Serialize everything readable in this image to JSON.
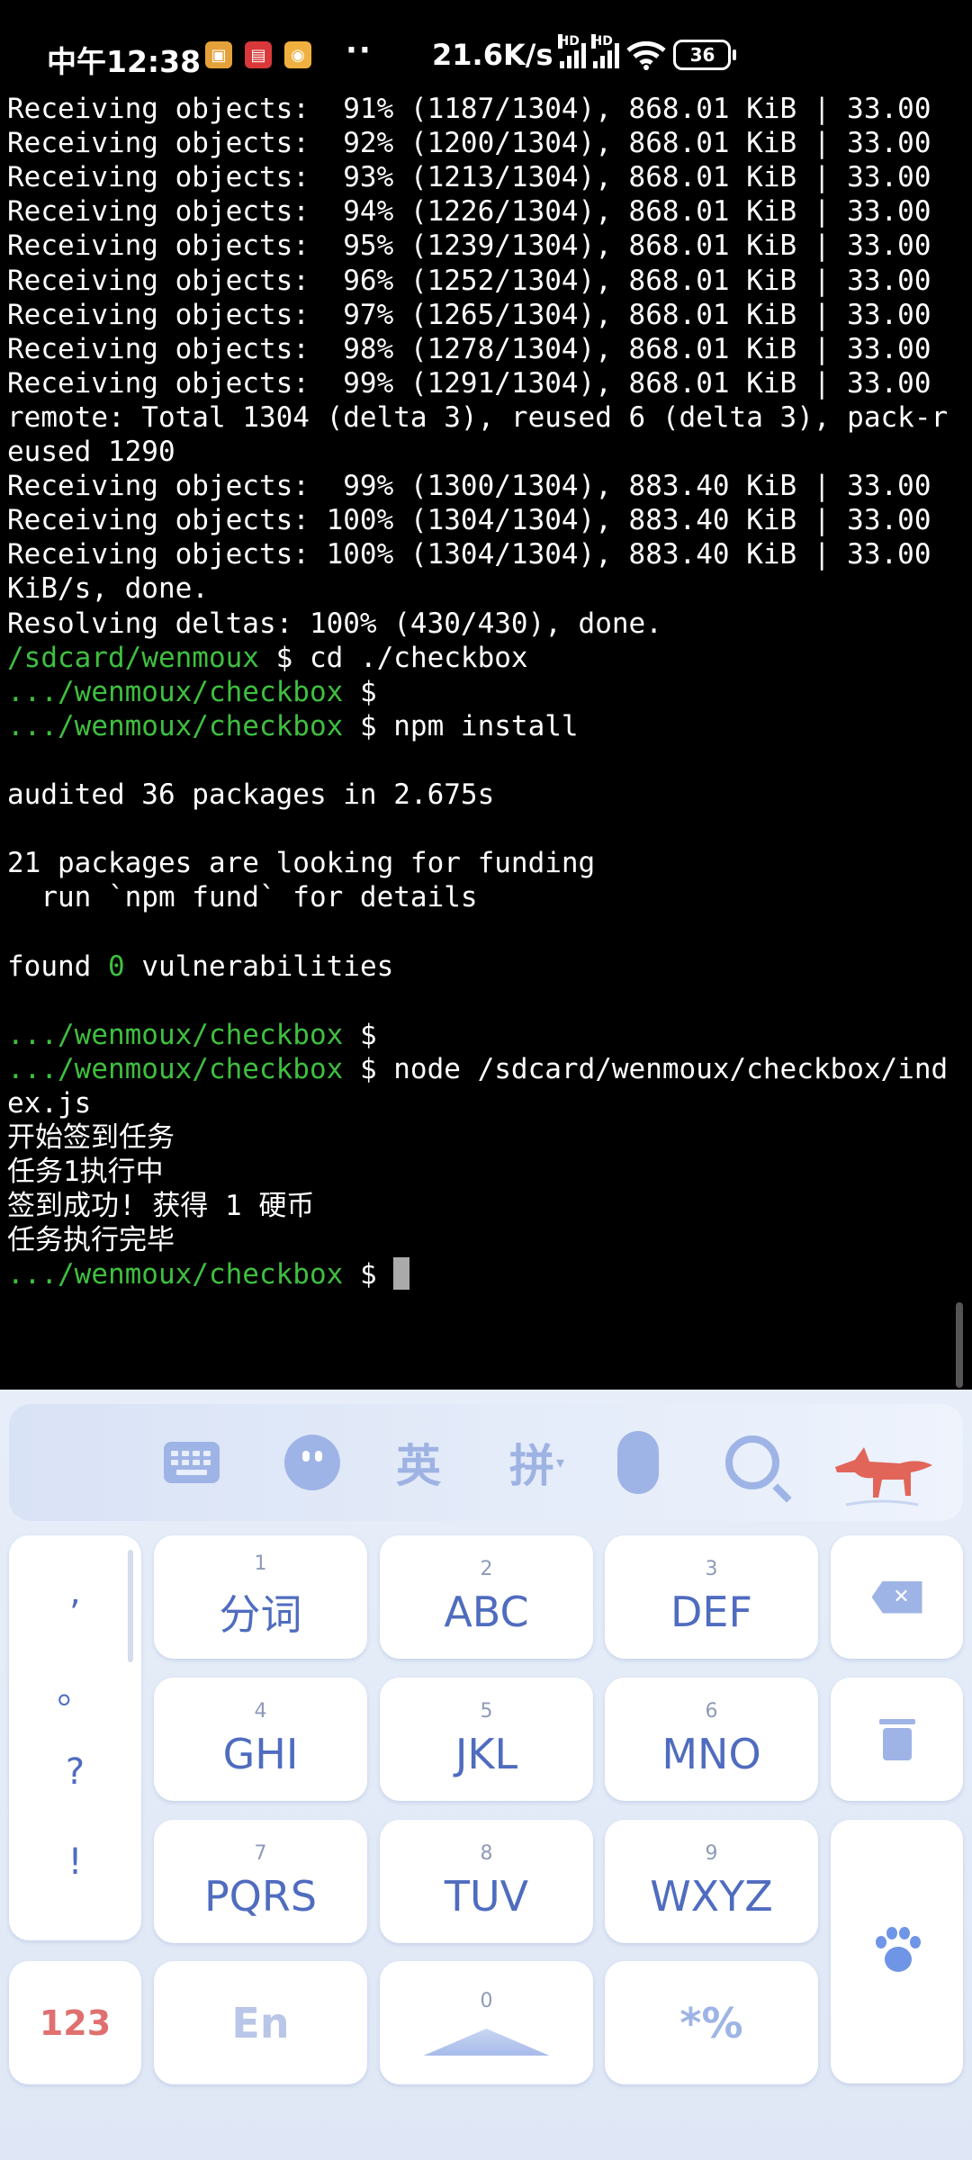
{
  "status_bar": {
    "time": "中午12:38",
    "dots": "··",
    "network_speed": "21.6K/s",
    "hd1": "HD",
    "hd2": "HD",
    "battery": "36"
  },
  "terminal": {
    "lines": [
      [
        {
          "t": "Receiving objects:  91% (1187/1304), 868.01 KiB | 33.00"
        }
      ],
      [
        {
          "t": "Receiving objects:  92% (1200/1304), 868.01 KiB | 33.00"
        }
      ],
      [
        {
          "t": "Receiving objects:  93% (1213/1304), 868.01 KiB | 33.00"
        }
      ],
      [
        {
          "t": "Receiving objects:  94% (1226/1304), 868.01 KiB | 33.00"
        }
      ],
      [
        {
          "t": "Receiving objects:  95% (1239/1304), 868.01 KiB | 33.00"
        }
      ],
      [
        {
          "t": "Receiving objects:  96% (1252/1304), 868.01 KiB | 33.00"
        }
      ],
      [
        {
          "t": "Receiving objects:  97% (1265/1304), 868.01 KiB | 33.00"
        }
      ],
      [
        {
          "t": "Receiving objects:  98% (1278/1304), 868.01 KiB | 33.00"
        }
      ],
      [
        {
          "t": "Receiving objects:  99% (1291/1304), 868.01 KiB | 33.00"
        }
      ],
      [
        {
          "t": "remote: Total 1304 (delta 3), reused 6 (delta 3), pack-r"
        }
      ],
      [
        {
          "t": "eused 1290"
        }
      ],
      [
        {
          "t": "Receiving objects:  99% (1300/1304), 883.40 KiB | 33.00"
        }
      ],
      [
        {
          "t": "Receiving objects: 100% (1304/1304), 883.40 KiB | 33.00"
        }
      ],
      [
        {
          "t": "Receiving objects: 100% (1304/1304), 883.40 KiB | 33.00"
        }
      ],
      [
        {
          "t": "KiB/s, done."
        }
      ],
      [
        {
          "t": "Resolving deltas: 100% (430/430), done."
        }
      ],
      [
        {
          "t": "/sdcard/wenmoux",
          "c": "green"
        },
        {
          "t": " $ cd ./checkbox"
        }
      ],
      [
        {
          "t": ".../wenmoux/checkbox",
          "c": "green"
        },
        {
          "t": " $"
        }
      ],
      [
        {
          "t": ".../wenmoux/checkbox",
          "c": "green"
        },
        {
          "t": " $ npm install"
        }
      ],
      [
        {
          "t": ""
        }
      ],
      [
        {
          "t": "audited 36 packages in 2.675s"
        }
      ],
      [
        {
          "t": ""
        }
      ],
      [
        {
          "t": "21 packages are looking for funding"
        }
      ],
      [
        {
          "t": "  run `npm fund` for details"
        }
      ],
      [
        {
          "t": ""
        }
      ],
      [
        {
          "t": "found "
        },
        {
          "t": "0",
          "c": "green"
        },
        {
          "t": " vulnerabilities"
        }
      ],
      [
        {
          "t": ""
        }
      ],
      [
        {
          "t": ".../wenmoux/checkbox",
          "c": "green"
        },
        {
          "t": " $"
        }
      ],
      [
        {
          "t": ".../wenmoux/checkbox",
          "c": "green"
        },
        {
          "t": " $ node /sdcard/wenmoux/checkbox/ind"
        }
      ],
      [
        {
          "t": "ex.js"
        }
      ],
      [
        {
          "t": "开始签到任务"
        }
      ],
      [
        {
          "t": "任务1执行中"
        }
      ],
      [
        {
          "t": "签到成功! 获得 1 硬币"
        }
      ],
      [
        {
          "t": "任务执行完毕"
        }
      ],
      [
        {
          "t": ".../wenmoux/checkbox",
          "c": "green"
        },
        {
          "t": " $ "
        },
        {
          "cursor": true
        }
      ]
    ]
  },
  "keyboard": {
    "toolbar": {
      "english": "英",
      "pinyin": "拼"
    },
    "punctuation": [
      ",",
      "。",
      "?",
      "!"
    ],
    "keys": [
      {
        "num": "1",
        "label": "分词"
      },
      {
        "num": "2",
        "label": "ABC"
      },
      {
        "num": "3",
        "label": "DEF"
      },
      {
        "num": "4",
        "label": "GHI"
      },
      {
        "num": "5",
        "label": "JKL"
      },
      {
        "num": "6",
        "label": "MNO"
      },
      {
        "num": "7",
        "label": "PQRS"
      },
      {
        "num": "8",
        "label": "TUV"
      },
      {
        "num": "9",
        "label": "WXYZ"
      }
    ],
    "bottom": {
      "num_key": "123",
      "en_key": "En",
      "space_num": "0",
      "symbol_key": "*%"
    }
  },
  "colors": {
    "terminal_green": "#3fbf3f",
    "key_text": "#4f6cbf",
    "num_key_text": "#e07070",
    "toolbar_icon": "#9fb4e6"
  }
}
